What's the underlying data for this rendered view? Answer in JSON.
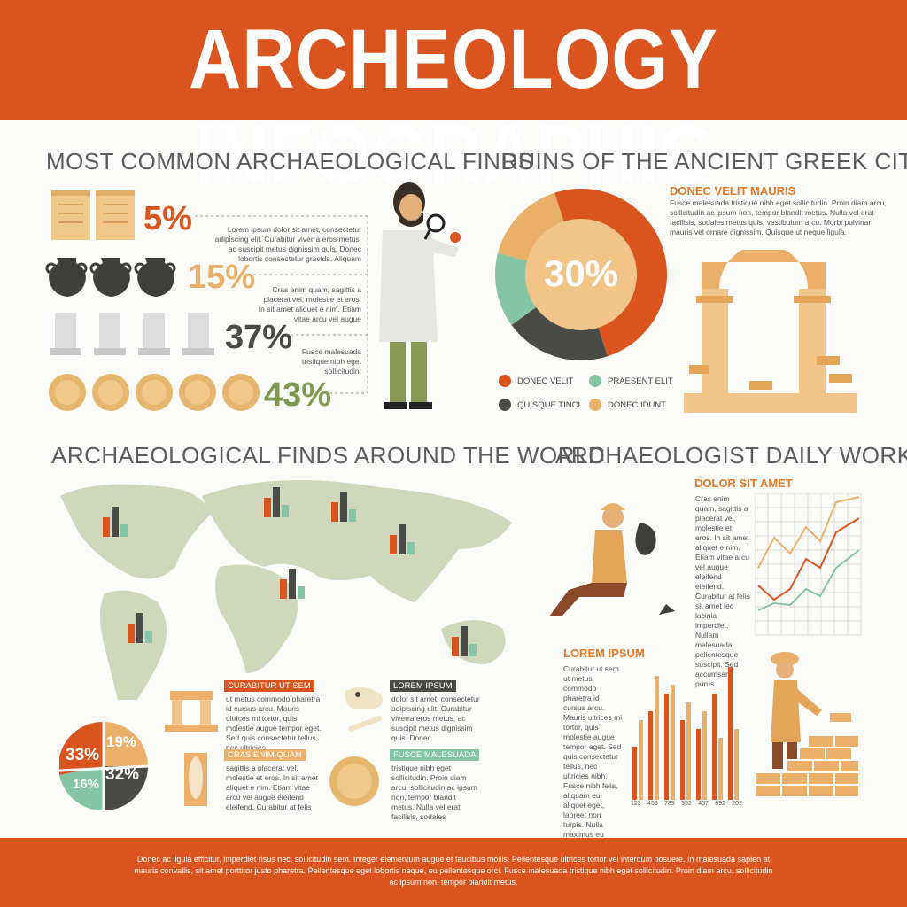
{
  "title": "ARCHEOLOGY INFOGRAPHIC",
  "colors": {
    "orange": "#d9541e",
    "dark": "#4a4a46",
    "mint": "#85c5a6",
    "sand": "#eab06a",
    "map": "#cfd8bb"
  },
  "finds": {
    "title": "MOST COMMON ARCHAEOLOGICAL FINDS",
    "rows": [
      {
        "icon": "scroll-icon",
        "count": 2,
        "percent": "5%",
        "color": "#d9541e"
      },
      {
        "icon": "vase-icon",
        "count": 3,
        "percent": "15%",
        "color": "#eab06a"
      },
      {
        "icon": "column-icon",
        "count": 4,
        "percent": "37%",
        "color": "#4a4a46"
      },
      {
        "icon": "coin-icon",
        "count": 5,
        "percent": "43%",
        "color": "#7e9a4f"
      }
    ],
    "texts": [
      "Lorem ipsum dolor sit amet, consectetur adipiscing elit. Curabitur viverra eros metus, ac suscipit metus dignissim quis. Donec lobortis consectetur gravida. Aliquam",
      "Cras enim quam, sagittis a placerat vel, molestie et eros. In sit amet aliquet e nim. Etiam vitae arcu vel augue",
      "Fusce malesuada tristique nibh eget sollicitudin."
    ]
  },
  "ruins": {
    "title": "RUINS OF THE ANCIENT GREEK CITY",
    "center_label": "30%",
    "subtitle": "DONEC VELIT MAURIS",
    "text": "Fusce malesuada tristique nibh eget sollicitudin. Proin diam arcu, sollicitudin ac ipsum non, tempor blandit metus. Nulla vel erat facilisis, sodales metus quis, vestibulum arcu. Morbi pulvinar mauris vel ornare dignissim. Quisque ut neque ligula.",
    "legend": [
      "DONEC VELIT",
      "PRAESENT ELIT",
      "QUISQUE TINCI",
      "DONEC IDUNT"
    ]
  },
  "world": {
    "title": "ARCHAEOLOGICAL FINDS AROUND THE WORLD",
    "pie_labels": [
      "19%",
      "33%",
      "32%",
      "16%"
    ],
    "items": [
      {
        "title": "CURABITUR UT SEM",
        "text": "ut metus commodo pharetra id cursus arcu. Mauris ultrices mi tortor, quis molestie augue tempor eget. Sed quis consectetur tellus, nec ultricies"
      },
      {
        "title": "LOREM IPSUM",
        "text": "dolor sit amet, consectetur adipiscing elit. Curabitur viverra eros metus, ac suscipit metus dignissim quis. Donec"
      },
      {
        "title": "CRAS ENIM QUAM",
        "text": "sagittis a placerat vel, molestie et eros. In sit amet aliquet e nim. Etiam vitae arcu vel augue eleifend eleifend. Curabitur at felis"
      },
      {
        "title": "FUSCE MALESUADA",
        "text": "tristique nibh eget sollicitudin. Proin diam arcu, sollicitudin ac ipsum non, tempor blandit metus. Nulla vel erat facilisis, sodales"
      }
    ]
  },
  "daily": {
    "title": "ARCHAEOLOGIST DAILY WORK",
    "sub1": "DOLOR SIT AMET",
    "text1": "Cras enim quam, sagittis a placerat vel, molestie et eros. In sit amet aliquet e nim. Etiam vitae arcu vel augue eleifend eleifend. Curabitur at felis sit amet leo lacinia imperdiet. Nullam malesuada pellentesque suscipit. Sed accumsan purus",
    "sub2": "LOREM IPSUM",
    "text2": "Curabitur ut sem ut metus commodo pharetra id cursus arcu. Mauris ultrices mi tortor, quis molestie augue tempor eget. Sed quis consectetur tellus, nec ultricies nibh. Fusce nibh felis, aliquam eu aliquet eget, laoreet non turpis. Nulla maximus eu turpis non facilisis.",
    "bar_labels": [
      "123",
      "456",
      "789",
      "352",
      "457",
      "892",
      "202"
    ]
  },
  "footer": "Donec ac ligula efficitur, imperdiet risus nec, sollicitudin sem. Integer elementum augue et faucibus mollis. Pellentesque ultrices tortor vel interdum posuere. In malesuada sapien at mauris convallis, sit amet porttitor justo pharetra. Pellentesque eget lobortis neque, eu pellentesque orci. Fusce malesuada tristique nibh eget sollicitudin. Proin diam arcu, sollicitudin ac ipsum non, tempor blandit metus."
}
